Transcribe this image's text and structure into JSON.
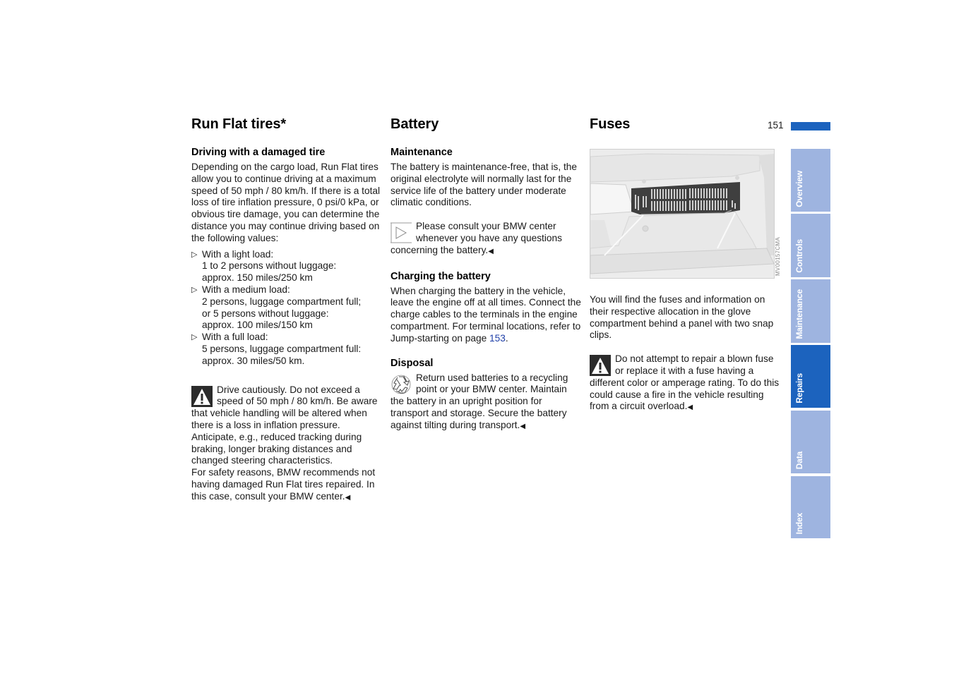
{
  "page": {
    "number": "151",
    "accent_color": "#1c63be",
    "tab_color": "#9eb4e0"
  },
  "tabs": [
    {
      "label": "Overview",
      "active": false
    },
    {
      "label": "Controls",
      "active": false
    },
    {
      "label": "Maintenance",
      "active": false
    },
    {
      "label": "Repairs",
      "active": true
    },
    {
      "label": "Data",
      "active": false
    },
    {
      "label": "Index",
      "active": false
    }
  ],
  "run_flat": {
    "title": "Run Flat tires*",
    "subtitle": "Driving with a damaged tire",
    "intro": "Depending on the cargo load, Run Flat tires allow you to continue driving at a maximum speed of 50 mph / 80 km/h. If there is a total loss of tire inflation pressure, 0 psi/0 kPa, or obvious tire damage, you can determine the distance you may continue driving based on the following values:",
    "bullet_glyph": "▷",
    "loads": [
      {
        "heading": "With a light load:",
        "lines": [
          "1 to 2 persons without luggage:",
          "approx. 150 miles/250 km"
        ]
      },
      {
        "heading": "With a medium load:",
        "lines": [
          "2 persons, luggage compartment full;",
          "or 5 persons without luggage:",
          "approx. 100 miles/150 km"
        ]
      },
      {
        "heading": "With a full load:",
        "lines": [
          "5 persons, luggage compartment full:",
          "approx. 30 miles/50 km."
        ]
      }
    ],
    "warning": "Drive cautiously. Do not exceed a speed of 50 mph / 80 km/h. Be aware that vehicle handling will be altered when there is a loss in inflation pressure. Anticipate, e.g., reduced tracking during braking, longer braking distances and changed steering characteristics.",
    "safety": "For safety reasons, BMW recommends not having damaged Run Flat tires repaired. In this case, consult your BMW center.",
    "end_mark": "◀"
  },
  "battery": {
    "title": "Battery",
    "maintenance_heading": "Maintenance",
    "maintenance_text": "The battery is maintenance-free, that is, the original electrolyte will normally last for the service life of the battery under moderate climatic conditions.",
    "note": "Please consult your BMW center whenever you have any questions concerning the battery.",
    "charging_heading": "Charging the battery",
    "charging_text_before": "When charging the battery in the vehicle, leave the engine off at all times. Connect the charge cables to the terminals in the engine compartment. For terminal locations, refer to Jump-starting on page ",
    "charging_link": "153",
    "charging_text_after": ".",
    "disposal_heading": "Disposal",
    "disposal_text": "Return used batteries to a recycling point or your BMW center. Maintain the battery in an upright position for transport and storage. Secure the battery against tilting during transport.",
    "end_mark": "◀"
  },
  "fuses": {
    "title": "Fuses",
    "figure_caption": "MV00157CMA",
    "text": "You will find the fuses and information on their respective allocation in the glove compartment behind a panel with two snap clips.",
    "warning": "Do not attempt to repair a blown fuse or replace it with a fuse having a different color or amperage rating. To do this could cause a fire in the vehicle resulting from a circuit overload.",
    "end_mark": "◀"
  }
}
